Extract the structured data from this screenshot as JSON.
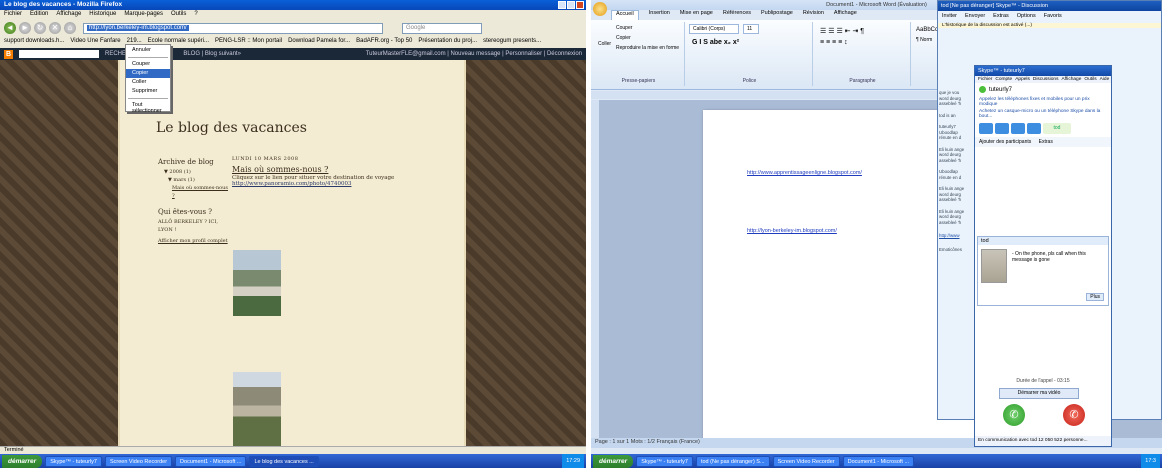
{
  "firefox": {
    "title": "Le blog des vacances - Mozilla Firefox",
    "menu": [
      "Fichier",
      "Edition",
      "Affichage",
      "Historique",
      "Marque-pages",
      "Outils",
      "?"
    ],
    "url": "http://lyon.berkeley-im.blogspot.com/",
    "search_placeholder": "Google",
    "bookmarks": [
      "support downloads.h...",
      "Video Une Fanfare",
      "219...",
      "Ecole normale supéri...",
      "PENG-LSR :: Mon portail",
      "Download Pamela for...",
      "BadAFR.org - Top 50",
      "Présentation du proj...",
      "stereogum presents..."
    ],
    "blogger_bar": {
      "search_label": "RECHERCHER",
      "next_blog": "BLOG | Blog suivant»",
      "right": "TuteurMasterFLE@gmail.com | Nouveau message | Personnaliser | Déconnexion"
    },
    "context_menu": [
      "Annuler",
      "Couper",
      "Copier",
      "Coller",
      "Supprimer",
      "Tout sélectionner"
    ],
    "context_selected": "Copier",
    "status": "Terminé"
  },
  "blog": {
    "title": "Le blog des vacances",
    "archive_heading": "Archive de blog",
    "archive_year": "▼ 2008 (1)",
    "archive_month": "▼ mars (1)",
    "archive_post": "Mais où sommes-nous ?",
    "who_heading": "Qui êtes-vous ?",
    "who_name": "ALLÔ BERKELEY ? ICI, LYON !",
    "profile_link": "Afficher mon profil complet",
    "post_date": "LUNDI 10 MARS 2008",
    "post_title": "Mais où sommes-nous ?",
    "post_body": "Cliquez sur le lien pour situer votre destination de voyage",
    "post_link": "http://www.panoramio.com/photo/4740003"
  },
  "word": {
    "title": "Document1 - Microsoft Word (Évaluation)",
    "tabs": [
      "Accueil",
      "Insertion",
      "Mise en page",
      "Références",
      "Publipostage",
      "Révision",
      "Affichage"
    ],
    "active_tab": "Accueil",
    "clipboard": [
      "Couper",
      "Copier",
      "Reproduire la mise en forme"
    ],
    "paste": "Coller",
    "font_name": "Calibri (Corps)",
    "font_size": "11",
    "group_labels": [
      "Presse-papiers",
      "Police",
      "Paragraphe"
    ],
    "style_sample": "AaBbCc",
    "style_name": "¶ Norm",
    "links": [
      "http://www.apprentissageenligne.blogspot.com/",
      "http://lyon-berkeley-im.blogspot.com/"
    ],
    "status": "Page : 1 sur 1   Mots : 1/2   Français (France)"
  },
  "skype_conv": {
    "title": "tod [Ne pas déranger] Skype™ - Discussion",
    "tools": [
      "Inviter",
      "Envoyer",
      "Extras",
      "Options",
      "Favoris"
    ],
    "notice": "L'historique de la discussion est activé (...)",
    "side_items": [
      "que je vou",
      "word deurg",
      "assebleé 'h",
      "tod is an",
      "tuteurly7",
      "Uboodlap",
      "rénute en d",
      "Eli kuin ange",
      "word deurg",
      "assebleé 'h",
      "Uboodlap",
      "rénute en d",
      "Eli kuin ange",
      "word deurg",
      "assebleé 'h",
      "Eli kuin ange",
      "word deurg",
      "assebleé 'h",
      "http://www",
      "Emoticônes"
    ]
  },
  "skype": {
    "title": "Skype™ - tuteurly7",
    "menu": [
      "Fichier",
      "Compte",
      "Appels",
      "Discussions",
      "Affichage",
      "Outils",
      "Aide"
    ],
    "user": "tuteurly7",
    "promo1": "Appelez les téléphones fixes et mobiles pour un prix modique",
    "promo2": "Achetez un casque-micro ou un téléphone Skype dans la bout...",
    "tab_label": "tod",
    "add_participants": "Ajouter des participants",
    "extras": "Extras",
    "chat_user": "tod",
    "chat_message": "- On the phone, pls call when this message is gone",
    "more_label": "Plus",
    "call_duration": "Durée de l'appel - 03:15",
    "video_btn": "Démarrer ma vidéo",
    "status": "En communication avec tod  12 050 522 personne..."
  },
  "taskbar_left": {
    "start": "démarrer",
    "items": [
      "Skype™ - tuteurly7",
      "Screen Video Recorder",
      "Document1 - Microsoft ...",
      "Le blog des vacances ..."
    ],
    "active": "Le blog des vacances ...",
    "clock": "17:29"
  },
  "taskbar_right": {
    "start": "démarrer",
    "items": [
      "Skype™ - tuteurly7",
      "tod (Ne pas déranger) S...",
      "Screen Video Recorder",
      "Document1 - Microsoft ..."
    ],
    "clock": "17:3"
  }
}
